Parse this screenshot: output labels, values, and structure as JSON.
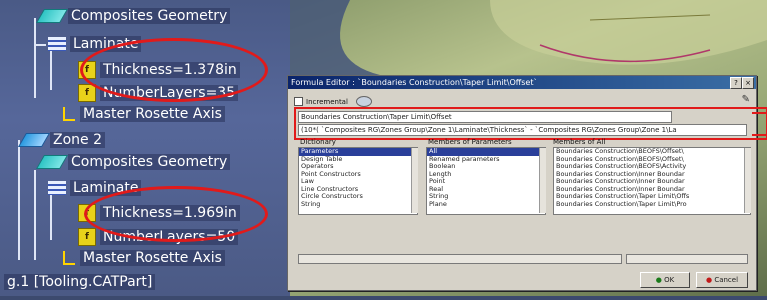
{
  "tree": {
    "composites_geometry_1": "Composites Geometry",
    "laminate_1": "Laminate",
    "thickness_1": "Thickness=1.378in",
    "number_layers_1": "NumberLayers=35",
    "master_rosette_1": "Master Rosette Axis",
    "zone_2": "Zone 2",
    "composites_geometry_2": "Composites Geometry",
    "laminate_2": "Laminate",
    "thickness_2": "Thickness=1.969in",
    "number_layers_2": "NumberLayers=50",
    "master_rosette_2": "Master Rosette Axis",
    "part": "g.1 [Tooling.CATPart]"
  },
  "dialog": {
    "title": "Formula Editor : `Boundaries Construction\\Taper Limit\\Offset`",
    "incremental_label": "Incremental",
    "parameter_field": "Boundaries Construction\\Taper Limit\\Offset",
    "formula_field": "(10*( `Composites RG\\Zones Group\\Zone 1\\Laminate\\Thickness` - `Composites RG\\Zones Group\\Zone 1\\La",
    "col_dictionary": "Dictionary",
    "col_members_params": "Members of Parameters",
    "col_members_all": "Members of All",
    "dictionary": [
      "Parameters",
      "Design Table",
      "Operators",
      "Point Constructors",
      "Law",
      "Line Constructors",
      "Circle Constructors",
      "String"
    ],
    "members_params": [
      "All",
      "Renamed parameters",
      "Boolean",
      "Length",
      "Point",
      "Real",
      "String",
      "Plane"
    ],
    "members_all": [
      "Boundaries Construction\\BEOFS\\Offset\\",
      "Boundaries Construction\\BEOFS\\Offset\\",
      "Boundaries Construction\\BEOFS\\Activity",
      "Boundaries Construction\\Inner Boundar",
      "Boundaries Construction\\Inner Boundar",
      "Boundaries Construction\\Inner Boundar",
      "Boundaries Construction\\Taper Limit\\Offs",
      "Boundaries Construction\\Taper Limit\\Pro"
    ],
    "ok_label": "OK",
    "cancel_label": "Cancel"
  },
  "colors": {
    "highlight": "#e11a1a",
    "title_bar": "#0a246a"
  }
}
